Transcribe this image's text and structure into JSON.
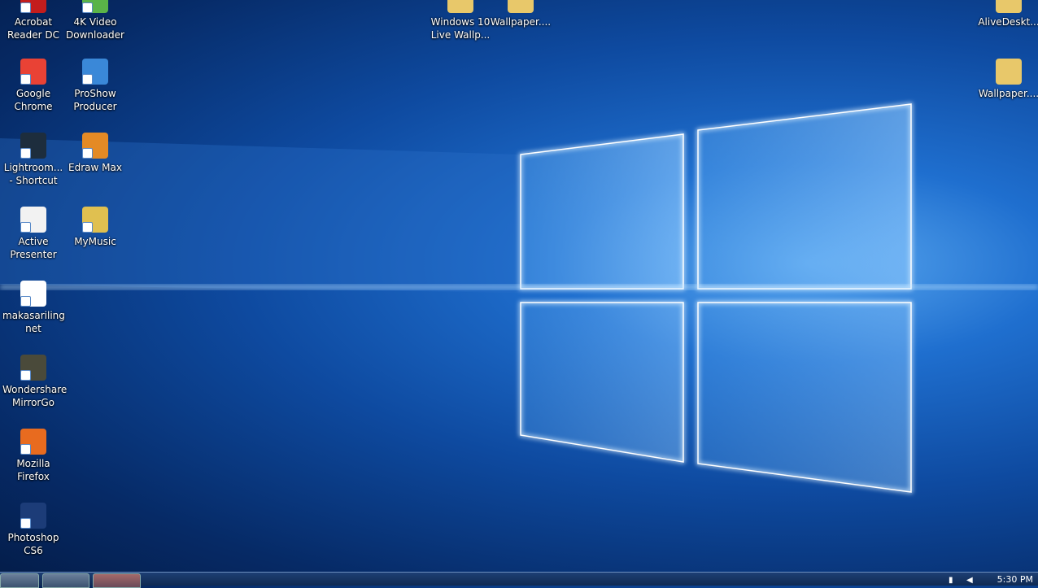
{
  "desktop_icons": [
    {
      "label": "Acrobat Reader DC",
      "color": "#c31d1d"
    },
    {
      "label": "4K Video Downloader",
      "color": "#5ab348"
    },
    {
      "label": "Google Chrome",
      "color": "#e94235"
    },
    {
      "label": "ProShow Producer",
      "color": "#3a88d8"
    },
    {
      "label": "Lightroom... - Shortcut",
      "color": "#1d2d3d"
    },
    {
      "label": "Edraw Max",
      "color": "#e48a25"
    },
    {
      "label": "Active Presenter",
      "color": "#f2f2f2"
    },
    {
      "label": "MyMusic",
      "color": "#e0c050"
    },
    {
      "label": "makasariling net",
      "color": "#ffffff"
    },
    {
      "label": "Wondershare MirrorGo",
      "color": "#4a4a3a"
    },
    {
      "label": "Mozilla Firefox",
      "color": "#e86b1f"
    },
    {
      "label": "Photoshop CS6",
      "color": "#1c3c78"
    },
    {
      "label": "Windows 10 Live Wallp...",
      "color": "#e8c86a"
    },
    {
      "label": "Wallpaper....",
      "color": "#e8c86a"
    },
    {
      "label": "AliveDeskt...",
      "color": "#e8c86a"
    },
    {
      "label": "Wallpaper....",
      "color": "#e8c86a"
    }
  ],
  "taskbar": {
    "apps": [
      "file-explorer",
      "media-player",
      "google-chrome"
    ],
    "clock": "5:30 PM"
  }
}
